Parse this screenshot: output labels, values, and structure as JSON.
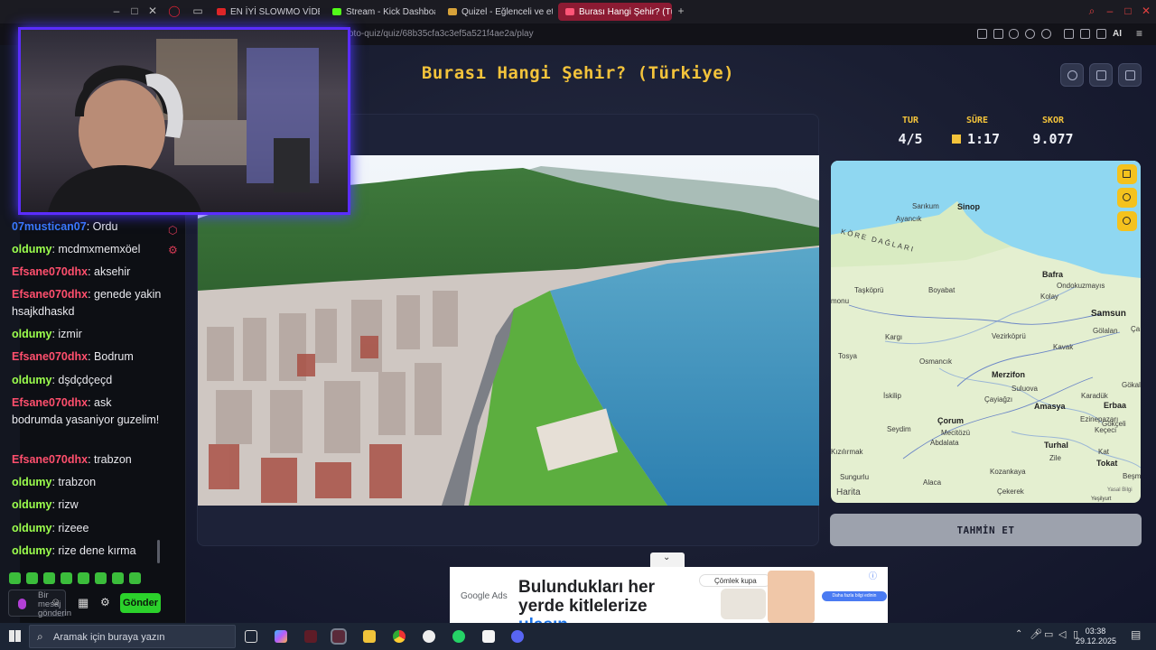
{
  "browser": {
    "tabs": [
      {
        "label": "EN İYİ SLOWMO VİDEOLA",
        "color": "#e02626"
      },
      {
        "label": "Stream - Kick Dashboard",
        "color": "#53fc18"
      },
      {
        "label": "Quizel - Eğlenceli ve etkile",
        "color": "#d7a23a"
      },
      {
        "label": "Burası Hangi Şehir? (Türki",
        "color": "#ff5577"
      }
    ],
    "url": "oto-quiz/quiz/68b35cfa3c3ef5a521f4ae2a/play",
    "ai_label": "AI"
  },
  "chat": {
    "messages": [
      {
        "user": "07mustican07",
        "text": ": Ordu",
        "color": "#3a7bff"
      },
      {
        "user": "oldumy",
        "text": ": mcdmxmemxöel",
        "color": "#9cff4d"
      },
      {
        "user": "Efsane070dhx",
        "text": ": aksehir",
        "color": "#ff4f6d"
      },
      {
        "user": "Efsane070dhx",
        "text": ": genede yakin hsajkdhaskd",
        "color": "#ff4f6d"
      },
      {
        "user": "oldumy",
        "text": ": izmir",
        "color": "#9cff4d"
      },
      {
        "user": "Efsane070dhx",
        "text": ": Bodrum",
        "color": "#ff4f6d"
      },
      {
        "user": "oldumy",
        "text": ": dşdçdçeçd",
        "color": "#9cff4d"
      },
      {
        "user": "Efsane070dhx",
        "text": ": ask bodrumda yasaniyor guzelim!",
        "color": "#ff4f6d"
      },
      {
        "user": "Efsane070dhx",
        "text": ": trabzon",
        "color": "#ff4f6d"
      },
      {
        "user": "oldumy",
        "text": ": trabzon",
        "color": "#9cff4d"
      },
      {
        "user": "oldumy",
        "text": ": rizw",
        "color": "#9cff4d"
      },
      {
        "user": "oldumy",
        "text": ": rizeee",
        "color": "#9cff4d"
      },
      {
        "user": "oldumy",
        "text": ": rize dene kırma",
        "color": "#9cff4d"
      }
    ],
    "input_placeholder": "Bir mesaj gönderin",
    "send_label": "Gönder"
  },
  "quiz": {
    "title": "Burası Hangi Şehir? (Türkiye)",
    "round_label": "TUR",
    "round_value": "4/5",
    "time_label": "SÜRE",
    "time_value": "1:17",
    "score_label": "SKOR",
    "score_value": "9.077",
    "guess_label": "TAHMİN ET"
  },
  "map": {
    "attribution": "Harita",
    "legal": "Yasal Bilgi",
    "labels": {
      "sinop": "Sinop",
      "samsun": "Samsun",
      "bafra": "Bafra",
      "ondokuzmayis": "Ondokuzmayıs",
      "kavak": "Kavak",
      "vezirkopru": "Vezirköprü",
      "merzifon": "Merzifon",
      "suluova": "Suluova",
      "amasya": "Amasya",
      "corum": "Çorum",
      "tokat": "Tokat",
      "turhal": "Turhal",
      "zile": "Zile",
      "erbaa": "Erbaa",
      "osmancik": "Osmancık",
      "iskilip": "İskilip",
      "boyabat": "Boyabat",
      "tasvkopru": "Taşköprü",
      "kargi": "Kargı",
      "tosya": "Tosya",
      "ayancik": "Ayancık",
      "sarikum": "Sarıkum",
      "kastamonu": "monu",
      "koredaglari": "KÖRE DAĞLARI",
      "gokal": "Gökal",
      "karadiken": "Karadük",
      "ezinepazari": "Ezinepazarı",
      "kecici": "Keçeci",
      "goksel": "Gökçeli",
      "kazova": "Kozankaya",
      "cekerek": "Çekerek",
      "alaca": "Alaca",
      "sungurlu": "Sungurlu",
      "kizilirmak": "Kızılırmak",
      "seydim": "Seydim",
      "mecitozu": "Mecitözü",
      "abdalata": "Abdalata",
      "cayiagzi": "Çayiağzı",
      "kolay": "Kolay",
      "golalan": "Gölalan",
      "yesilyurt": "Yeşilyurt",
      "kat": "Kat",
      "besmilat": "Beşmilat",
      "ca": "Ça"
    }
  },
  "ad": {
    "brand": "Google Ads",
    "headline_1": "Bulundukları her yerde kitlelerize",
    "headline_2": "ulaşın.",
    "search_text": "Çömlek kupa",
    "cta": "Daha fazla bilgi edinin"
  },
  "taskbar": {
    "search_placeholder": "Aramak için buraya yazın",
    "time": "03:38",
    "date": "29.12.2025"
  }
}
